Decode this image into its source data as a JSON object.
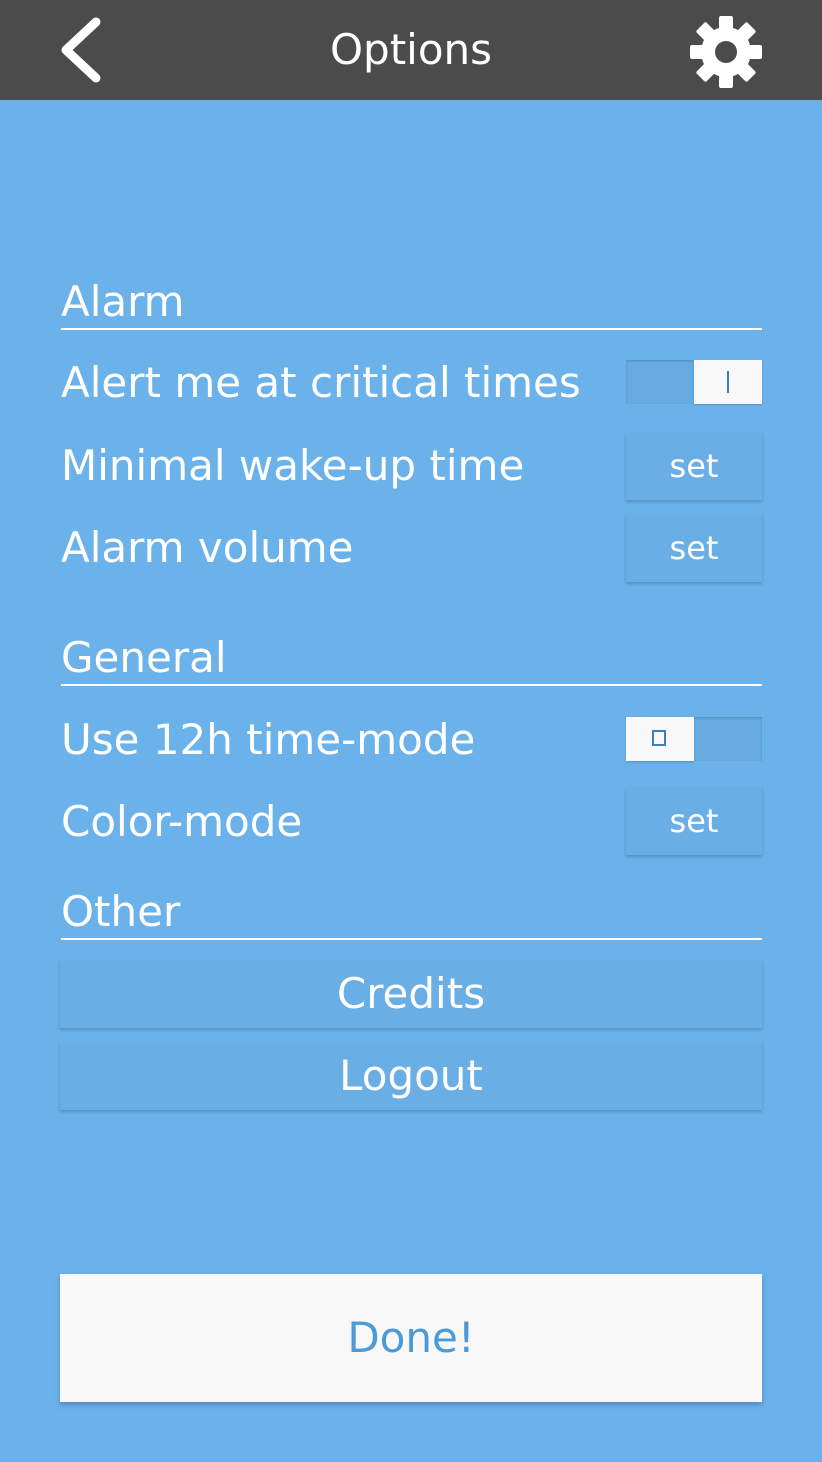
{
  "header": {
    "title": "Options",
    "back_icon": "chevron-left-icon",
    "settings_icon": "gear-icon"
  },
  "sections": {
    "alarm": {
      "title": "Alarm",
      "alert_label": "Alert me at critical times",
      "alert_toggle_on": true,
      "wakeup_label": "Minimal wake-up time",
      "wakeup_button": "set",
      "volume_label": "Alarm volume",
      "volume_button": "set"
    },
    "general": {
      "title": "General",
      "time_mode_label": "Use 12h time-mode",
      "time_mode_toggle_on": false,
      "color_mode_label": "Color-mode",
      "color_mode_button": "set"
    },
    "other": {
      "title": "Other",
      "credits_button": "Credits",
      "logout_button": "Logout"
    }
  },
  "footer": {
    "done_button": "Done!"
  },
  "colors": {
    "background": "#6cb2ea",
    "topbar": "#4b4b4b",
    "done_text": "#4a9ad8"
  }
}
